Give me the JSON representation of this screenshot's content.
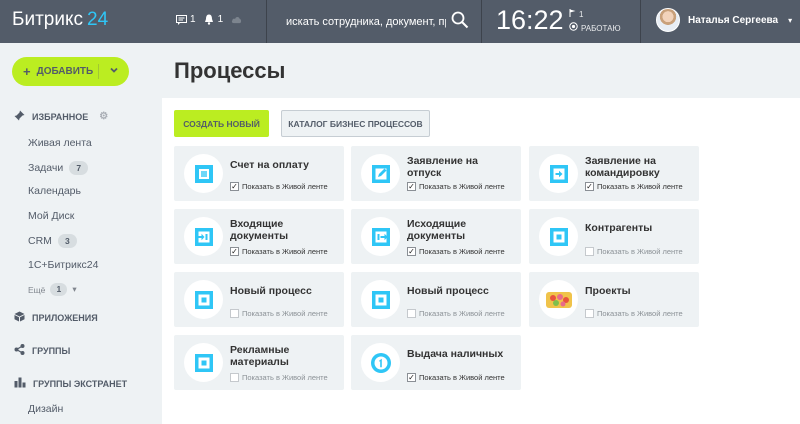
{
  "header": {
    "logo_text": "Битрикс",
    "logo_num": "24",
    "messages_count": "1",
    "notifications_count": "1",
    "search_placeholder": "искать сотрудника, документ, прочее...",
    "time": "16:22",
    "flag_count": "1",
    "work_status": "РАБОТАЮ",
    "user_name": "Наталья Сергеева",
    "accent": "#2fc6f6"
  },
  "sidebar": {
    "add_label": "ДОБАВИТЬ",
    "favorites_title": "ИЗБРАННОЕ",
    "items": [
      {
        "label": "Живая лента",
        "badge": ""
      },
      {
        "label": "Задачи",
        "badge": "7"
      },
      {
        "label": "Календарь",
        "badge": ""
      },
      {
        "label": "Мой Диск",
        "badge": ""
      },
      {
        "label": "CRM",
        "badge": "3"
      },
      {
        "label": "1С+Битрикс24",
        "badge": ""
      }
    ],
    "more_label": "Ещё",
    "more_badge": "1",
    "apps_title": "ПРИЛОЖЕНИЯ",
    "groups_title": "ГРУППЫ",
    "extranet_title": "ГРУППЫ ЭКСТРАНЕТ",
    "extranet_items": [
      "Дизайн"
    ]
  },
  "main": {
    "page_title": "Процессы",
    "create_label": "СОЗДАТЬ НОВЫЙ",
    "catalog_label": "КАТАЛОГ БИЗНЕС ПРОЦЕССОВ",
    "show_in_feed": "Показать в Живой ленте",
    "cards": [
      {
        "title": "Счет на оплату",
        "checked": true,
        "icon": "invoice-icon"
      },
      {
        "title": "Заявление на отпуск",
        "checked": true,
        "icon": "vacation-request-icon"
      },
      {
        "title": "Заявление на командировку",
        "checked": true,
        "icon": "business-trip-icon"
      },
      {
        "title": "Входящие документы",
        "checked": true,
        "icon": "incoming-documents-icon"
      },
      {
        "title": "Исходящие документы",
        "checked": true,
        "icon": "outgoing-documents-icon"
      },
      {
        "title": "Контрагенты",
        "checked": false,
        "icon": "counterparties-icon"
      },
      {
        "title": "Новый процесс",
        "checked": false,
        "icon": "new-process-icon"
      },
      {
        "title": "Новый процесс",
        "checked": false,
        "icon": "new-process-icon"
      },
      {
        "title": "Проекты",
        "checked": false,
        "icon": "projects-icon"
      },
      {
        "title": "Рекламные материалы",
        "checked": false,
        "icon": "ad-materials-icon"
      },
      {
        "title": "Выдача наличных",
        "checked": true,
        "icon": "cash-issue-icon"
      }
    ]
  }
}
